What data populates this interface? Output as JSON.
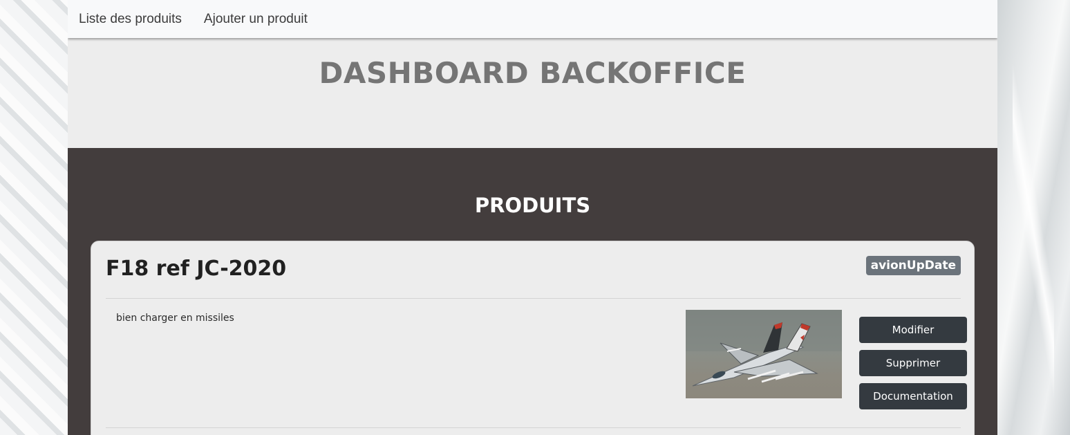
{
  "navbar": {
    "links": [
      {
        "label": "Liste des produits"
      },
      {
        "label": "Ajouter un produit"
      }
    ]
  },
  "hero": {
    "title": "DASHBOARD BACKOFFICE"
  },
  "section": {
    "title": "PRODUITS"
  },
  "product": {
    "title": "F18 ref JC-2020",
    "badge": "avionUpDate",
    "description": "bien charger en missiles",
    "image_alt": "jet-fighter-image",
    "buttons": {
      "modify": "Modifier",
      "delete": "Supprimer",
      "documentation": "Documentation"
    }
  },
  "colors": {
    "navbar_bg": "#f8f9fa",
    "hero_bg": "#ededed",
    "section_bg": "#433d3d",
    "card_bg": "#ededed",
    "button_bg": "#343a40",
    "badge_bg": "#6b737b"
  }
}
